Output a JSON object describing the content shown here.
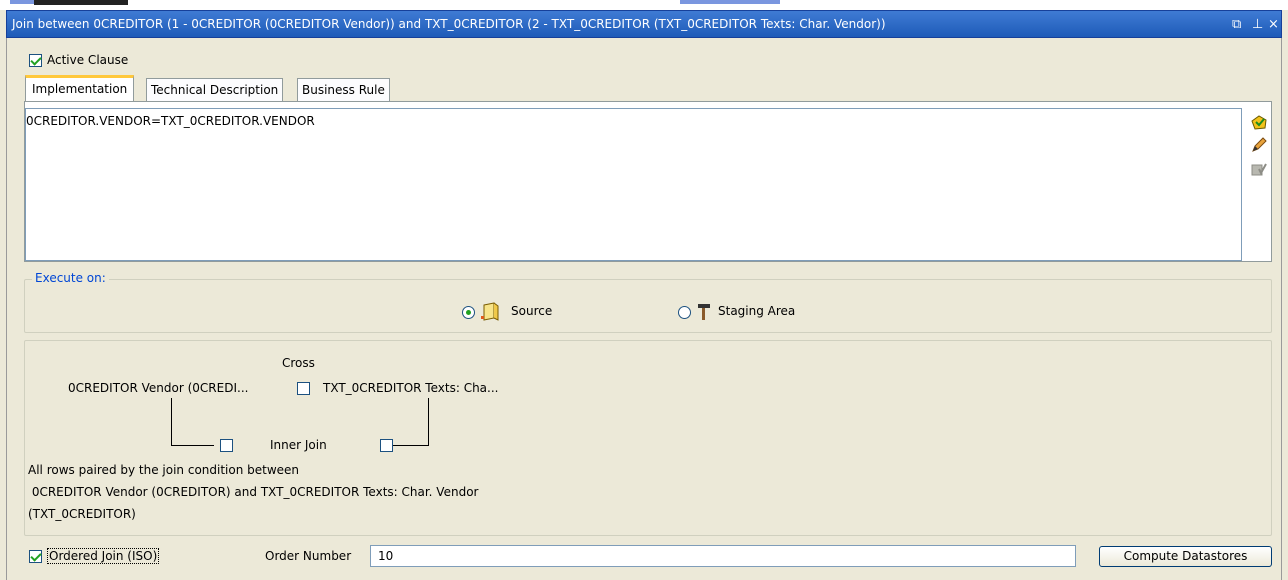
{
  "window": {
    "title": "Join between 0CREDITOR (1 - 0CREDITOR (0CREDITOR Vendor)) and TXT_0CREDITOR (2 - TXT_0CREDITOR (TXT_0CREDITOR Texts: Char. Vendor))",
    "controls": {
      "restore": "⧉",
      "pin": "⊥",
      "close": "×"
    }
  },
  "active_clause": {
    "label": "Active Clause",
    "checked": true
  },
  "tabs": [
    {
      "label": "Implementation",
      "active": true
    },
    {
      "label": "Technical Description",
      "active": false
    },
    {
      "label": "Business Rule",
      "active": false
    }
  ],
  "editor": {
    "text": "0CREDITOR.VENDOR=TXT_0CREDITOR.VENDOR"
  },
  "side_icons": [
    "expression-editor-icon",
    "pencil-icon",
    "check-disabled-icon"
  ],
  "execute_on": {
    "legend": "Execute on:",
    "options": [
      {
        "label": "Source",
        "selected": true,
        "icon": "source-datastore-icon"
      },
      {
        "label": "Staging Area",
        "selected": false,
        "icon": "staging-hammer-icon"
      }
    ]
  },
  "join_type": {
    "cross_label": "Cross",
    "left_datastore": "0CREDITOR Vendor (0CREDI...",
    "right_datastore": "TXT_0CREDITOR Texts: Cha...",
    "inner_join_label": "Inner Join",
    "description_line1": "All rows paired by the join condition between",
    "description_line2": " 0CREDITOR Vendor (0CREDITOR) and TXT_0CREDITOR Texts: Char. Vendor",
    "description_line3": "(TXT_0CREDITOR)"
  },
  "ordered_join": {
    "label": "Ordered Join (ISO)",
    "checked": true
  },
  "order_number": {
    "label": "Order Number",
    "value": "10"
  },
  "compute_button": {
    "label": "Compute Datastores"
  }
}
